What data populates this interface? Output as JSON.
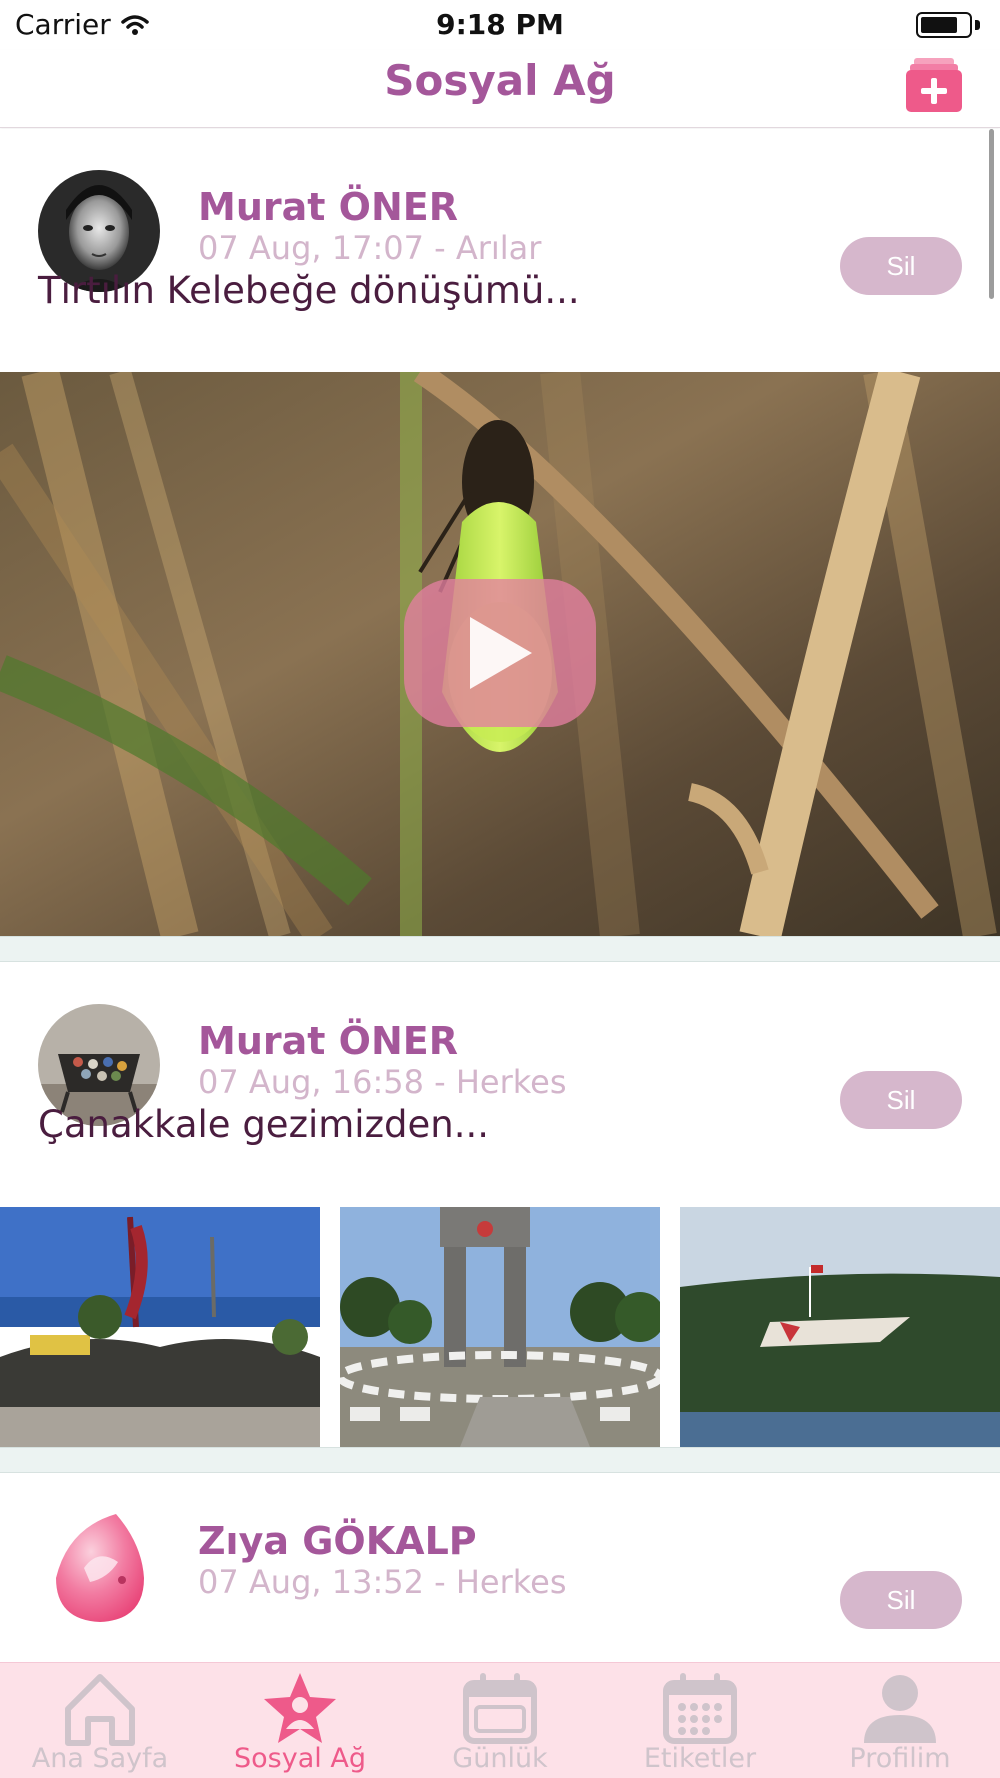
{
  "status_bar": {
    "carrier": "Carrier",
    "time": "9:18 PM",
    "battery_level": 0.78
  },
  "nav": {
    "title": "Sosyal Ağ",
    "add_icon": "add-post-icon"
  },
  "posts": [
    {
      "author": "Murat ÖNER",
      "meta": "07 Aug, 17:07 - Arılar",
      "delete_label": "Sil",
      "text": "Tırtılın Kelebeğe dönüşümü...",
      "media": "video"
    },
    {
      "author": "Murat ÖNER",
      "meta": "07 Aug, 16:58 - Herkes",
      "delete_label": "Sil",
      "text": "Çanakkale gezimizden...",
      "media": "photos",
      "photo_count": 3
    },
    {
      "author": "Zıya GÖKALP",
      "meta": "07 Aug, 13:52 - Herkes",
      "delete_label": "Sil",
      "text": ""
    }
  ],
  "tabs": [
    {
      "label": "Ana Sayfa",
      "icon": "home-icon",
      "active": false
    },
    {
      "label": "Sosyal Ağ",
      "icon": "star-people-icon",
      "active": true
    },
    {
      "label": "Günlük",
      "icon": "calendar-icon",
      "active": false
    },
    {
      "label": "Etiketler",
      "icon": "calendar-grid-icon",
      "active": false
    },
    {
      "label": "Profilim",
      "icon": "person-icon",
      "active": false
    }
  ],
  "colors": {
    "brand": "#a4579a",
    "accent": "#ee5a8a",
    "tab_bg": "#fde1e8",
    "delete_btn": "#d6b7cc"
  }
}
